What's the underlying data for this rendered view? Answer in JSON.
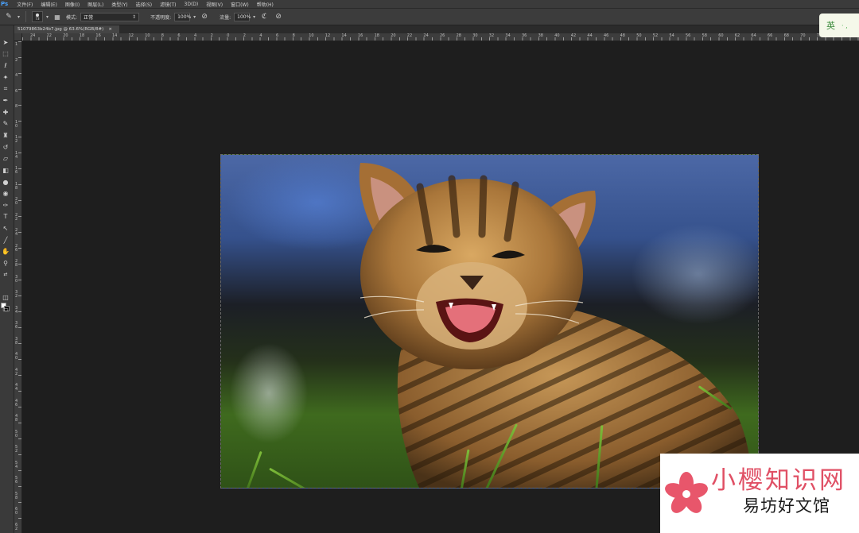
{
  "app": {
    "logo": "Ps",
    "menu": [
      "文件(F)",
      "编辑(E)",
      "图像(I)",
      "图层(L)",
      "类型(Y)",
      "选择(S)",
      "滤镜(T)",
      "3D(D)",
      "视图(V)",
      "窗口(W)",
      "帮助(H)"
    ]
  },
  "options": {
    "brush_size": "73",
    "mode_label": "模式:",
    "mode_value": "正常",
    "opacity_label": "不透明度:",
    "opacity_value": "100%",
    "flow_label": "流量:",
    "flow_value": "100%"
  },
  "document": {
    "tab_title": "51079863b24b7.jpg @ 63.6%(RGB/8#)",
    "close": "×"
  },
  "rulers": {
    "top": [
      "24",
      "22",
      "20",
      "18",
      "16",
      "14",
      "12",
      "10",
      "8",
      "6",
      "4",
      "2",
      "0",
      "2",
      "4",
      "6",
      "8",
      "10",
      "12",
      "14",
      "16",
      "18",
      "20",
      "22",
      "24",
      "26",
      "28",
      "30",
      "32",
      "34",
      "36",
      "38",
      "40",
      "42",
      "44",
      "46",
      "48",
      "50",
      "52",
      "54",
      "56",
      "58",
      "60",
      "62",
      "64",
      "66",
      "68",
      "70",
      "72",
      "74"
    ],
    "left": [
      "1",
      "2",
      "4",
      "6",
      "8",
      "10",
      "12",
      "14",
      "16",
      "18",
      "20",
      "22",
      "24",
      "26",
      "28",
      "30",
      "32",
      "34",
      "36",
      "38",
      "40",
      "42",
      "44",
      "46",
      "48",
      "50",
      "52",
      "54",
      "56",
      "58",
      "60",
      "62"
    ]
  },
  "ime": {
    "label": "英",
    "dots": "· ,"
  },
  "watermark": {
    "line1": "小樱知识网",
    "line2": "易坊好文馆"
  },
  "colors": {
    "foreground": "#ffffff",
    "background": "#000000"
  }
}
